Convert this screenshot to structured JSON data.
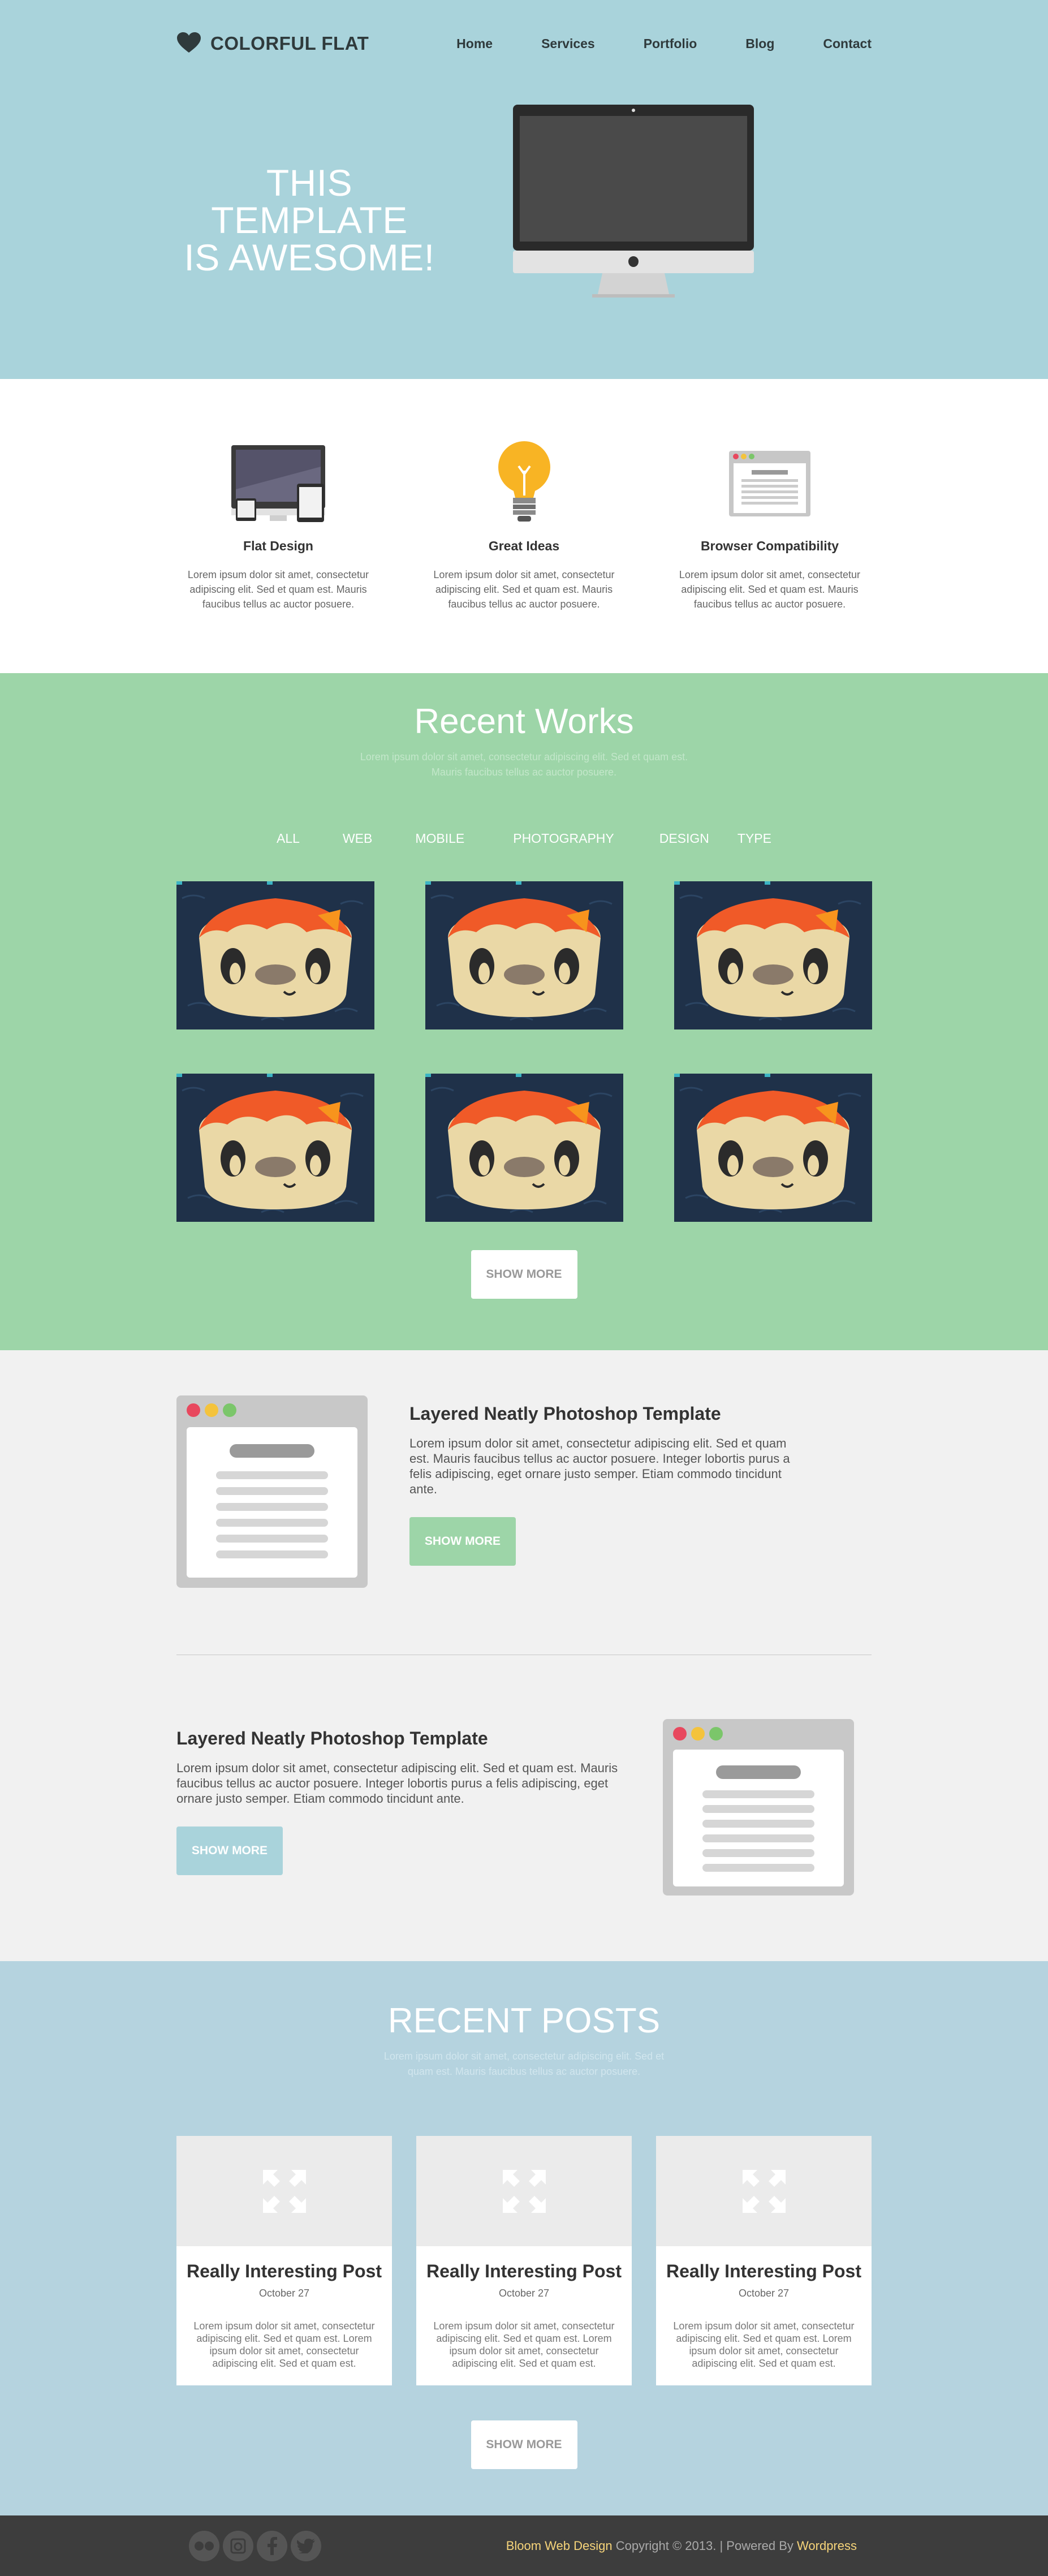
{
  "header": {
    "logo_text": "COLORFUL FLAT",
    "nav": [
      "Home",
      "Services",
      "Portfolio",
      "Blog",
      "Contact"
    ]
  },
  "hero": {
    "title_line1": "THIS TEMPLATE",
    "title_line2": "IS AWESOME!"
  },
  "features": [
    {
      "title": "Flat Design",
      "icon": "devices-icon",
      "text": "Lorem ipsum dolor sit amet, consectetur adipiscing elit. Sed et quam est. Mauris faucibus tellus ac auctor posuere."
    },
    {
      "title": "Great Ideas",
      "icon": "lightbulb-icon",
      "text": "Lorem ipsum dolor sit amet, consectetur adipiscing elit. Sed et quam est. Mauris faucibus tellus ac auctor posuere."
    },
    {
      "title": "Browser Compatibility",
      "icon": "browser-icon",
      "text": "Lorem ipsum dolor sit amet, consectetur adipiscing elit. Sed et quam est. Mauris faucibus tellus ac auctor posuere."
    }
  ],
  "works": {
    "title": "Recent Works",
    "subtitle": "Lorem ipsum dolor sit amet, consectetur adipiscing elit. Sed et quam est. Mauris faucibus tellus ac auctor posuere.",
    "filters": [
      "ALL",
      "WEB",
      "MOBILE",
      "PHOTOGRAPHY",
      "DESIGN",
      "TYPE"
    ],
    "show_more": "SHOW MORE"
  },
  "layered": [
    {
      "title": "Layered Neatly Photoshop Template",
      "text": "Lorem ipsum dolor sit amet, consectetur adipiscing elit. Sed et quam est. Mauris faucibus tellus ac auctor posuere. Integer lobortis purus a felis adipiscing, eget ornare justo semper. Etiam commodo tincidunt ante.",
      "button": "SHOW MORE",
      "accent": "#9dd5a8"
    },
    {
      "title": "Layered Neatly Photoshop Template",
      "text": "Lorem ipsum dolor sit amet, consectetur adipiscing elit. Sed et quam est. Mauris faucibus tellus ac auctor posuere. Integer lobortis purus a felis adipiscing, eget ornare justo semper. Etiam commodo tincidunt ante.",
      "button": "SHOW MORE",
      "accent": "#a9d3db"
    }
  ],
  "posts": {
    "title": "RECENT POSTS",
    "subtitle": "Lorem ipsum dolor sit amet, consectetur adipiscing elit. Sed et quam est. Mauris faucibus tellus ac auctor posuere.",
    "items": [
      {
        "title": "Really Interesting Post",
        "date": "October 27",
        "text": "Lorem ipsum dolor sit amet, consectetur adipiscing elit. Sed et quam est. Lorem ipsum dolor sit amet, consectetur adipiscing elit. Sed et quam est."
      },
      {
        "title": "Really Interesting Post",
        "date": "October 27",
        "text": "Lorem ipsum dolor sit amet, consectetur adipiscing elit. Sed et quam est. Lorem ipsum dolor sit amet, consectetur adipiscing elit. Sed et quam est."
      },
      {
        "title": "Really Interesting Post",
        "date": "October 27",
        "text": "Lorem ipsum dolor sit amet, consectetur adipiscing elit. Sed et quam est. Lorem ipsum dolor sit amet, consectetur adipiscing elit. Sed et quam est."
      }
    ],
    "show_more": "SHOW MORE"
  },
  "footer": {
    "brand": "Bloom Web Design",
    "copyright": " Copyright © 2013. | Powered By ",
    "powered": "Wordpress",
    "social_icons": [
      "flickr-icon",
      "instagram-icon",
      "facebook-icon",
      "twitter-icon"
    ]
  },
  "colors": {
    "hero_bg": "#a9d3db",
    "works_bg": "#9dd5a8",
    "layered_bg": "#f1f1f1",
    "posts_bg": "#b5d3df",
    "footer_bg": "#3d3d3d",
    "footer_highlight": "#f6d47a"
  }
}
